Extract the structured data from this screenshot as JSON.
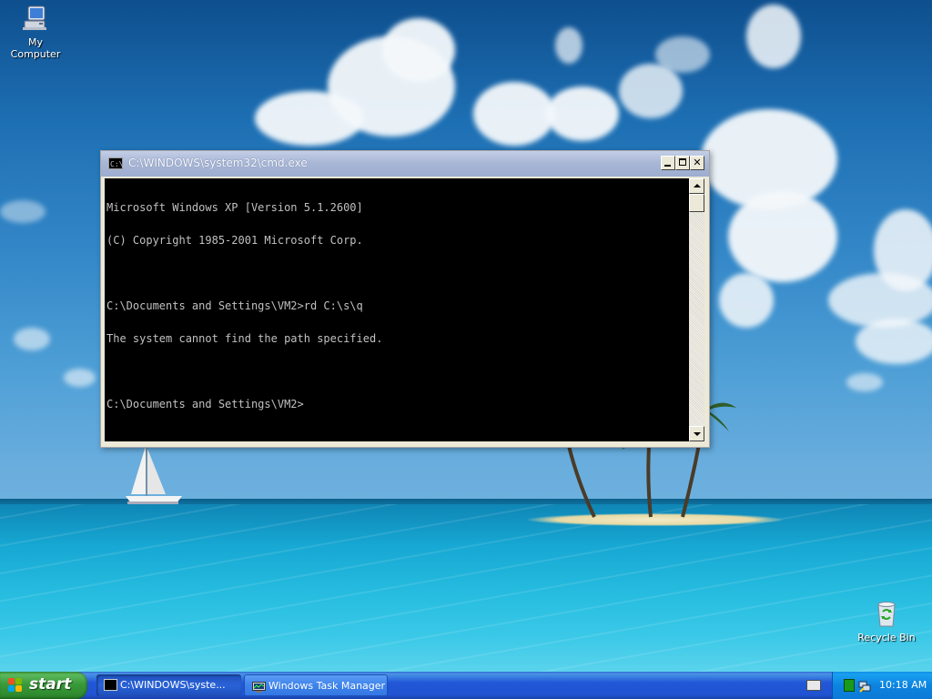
{
  "desktop": {
    "icons": [
      {
        "label": "My Computer"
      },
      {
        "label": "Recycle Bin"
      }
    ]
  },
  "window": {
    "title": "C:\\WINDOWS\\system32\\cmd.exe",
    "console_lines": [
      "Microsoft Windows XP [Version 5.1.2600]",
      "(C) Copyright 1985-2001 Microsoft Corp.",
      "",
      "C:\\Documents and Settings\\VM2>rd C:\\s\\q",
      "The system cannot find the path specified.",
      "",
      "C:\\Documents and Settings\\VM2>"
    ]
  },
  "taskbar": {
    "start_label": "start",
    "tasks": [
      {
        "label": "C:\\WINDOWS\\syste...",
        "icon": "cmd-icon",
        "active": true
      },
      {
        "label": "Windows Task Manager",
        "icon": "task-manager-icon",
        "active": false
      }
    ],
    "clock": "10:18 AM"
  },
  "colors": {
    "console_bg": "#000000",
    "console_text": "#c0c0c0",
    "taskbar_blue": "#2157d7",
    "start_green": "#3a9a3a"
  }
}
